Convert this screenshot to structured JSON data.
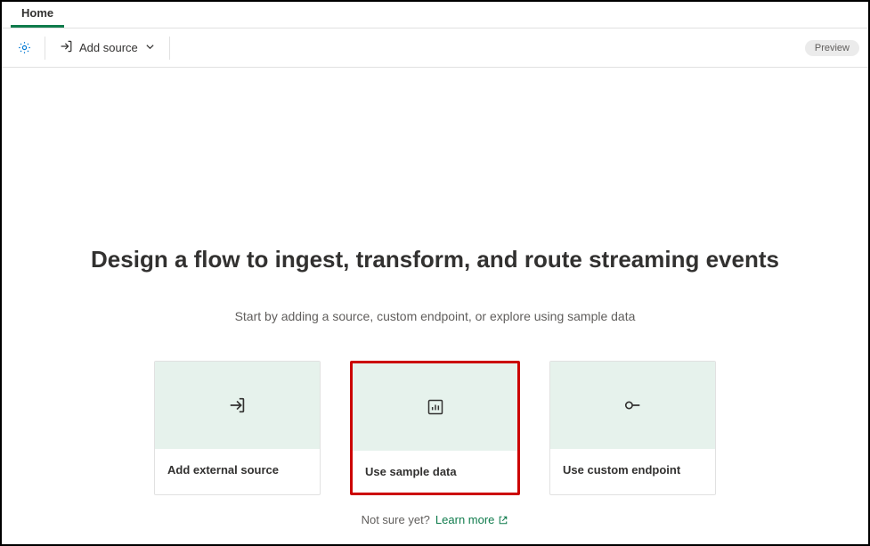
{
  "tabs": {
    "home": "Home"
  },
  "toolbar": {
    "add_source_label": "Add source",
    "preview_badge": "Preview"
  },
  "content": {
    "heading": "Design a flow to ingest, transform, and route streaming events",
    "subtitle": "Start by adding a source, custom endpoint, or explore using sample data",
    "cards": {
      "external": "Add external source",
      "sample": "Use sample data",
      "endpoint": "Use custom endpoint"
    },
    "footer_prefix": "Not sure yet?",
    "learn_more": "Learn more"
  }
}
